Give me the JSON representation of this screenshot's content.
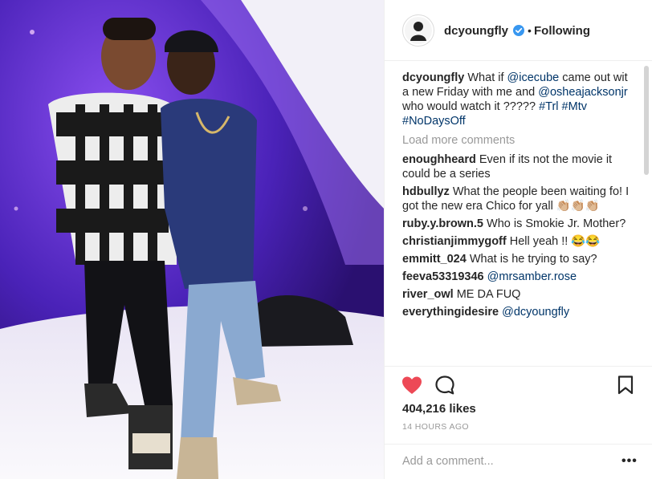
{
  "post": {
    "username": "dcyoungfly",
    "follow_status": "Following",
    "dot": "•"
  },
  "comments": [
    {
      "user": "dcyoungfly",
      "parts": [
        {
          "t": "text",
          "v": "What if "
        },
        {
          "t": "mention",
          "v": "@icecube"
        },
        {
          "t": "text",
          "v": " came out wit a new Friday with me and "
        },
        {
          "t": "mention",
          "v": "@osheajacksonjr"
        },
        {
          "t": "text",
          "v": " who would watch it ????? "
        },
        {
          "t": "mention",
          "v": "#Trl"
        },
        {
          "t": "text",
          "v": " "
        },
        {
          "t": "mention",
          "v": "#Mtv"
        },
        {
          "t": "text",
          "v": " "
        },
        {
          "t": "mention",
          "v": "#NoDaysOff"
        }
      ]
    },
    {
      "user": "enoughheard",
      "parts": [
        {
          "t": "text",
          "v": "Even if its not the movie it could be a series"
        }
      ]
    },
    {
      "user": "hdbullyz",
      "parts": [
        {
          "t": "text",
          "v": "What the people been waiting fo! I got the new era Chico for yall 👏🏼👏🏼👏🏼"
        }
      ]
    },
    {
      "user": "ruby.y.brown.5",
      "parts": [
        {
          "t": "text",
          "v": "Who is Smokie Jr. Mother?"
        }
      ]
    },
    {
      "user": "christianjimmygoff",
      "parts": [
        {
          "t": "text",
          "v": "Hell yeah !! 😂😂"
        }
      ]
    },
    {
      "user": "emmitt_024",
      "parts": [
        {
          "t": "text",
          "v": "What is he trying to say?"
        }
      ]
    },
    {
      "user": "feeva53319346",
      "parts": [
        {
          "t": "mention",
          "v": "@mrsamber.rose"
        }
      ]
    },
    {
      "user": "river_owl",
      "parts": [
        {
          "t": "text",
          "v": "ME DA FUQ"
        }
      ]
    },
    {
      "user": "everythingidesire",
      "parts": [
        {
          "t": "mention",
          "v": "@dcyoungfly"
        }
      ]
    }
  ],
  "load_more": "Load more comments",
  "likes": "404,216 likes",
  "timestamp": "14 HOURS AGO",
  "add_comment": {
    "placeholder": "Add a comment...",
    "value": ""
  },
  "more_options": "•••",
  "icons": {
    "heart": "heart-icon",
    "comment": "comment-icon",
    "bookmark": "bookmark-icon",
    "verified": "verified-badge-icon"
  },
  "colors": {
    "heart": "#ed4956",
    "mention": "#003569",
    "muted": "#999999",
    "text": "#262626",
    "verified": "#3897f0"
  }
}
